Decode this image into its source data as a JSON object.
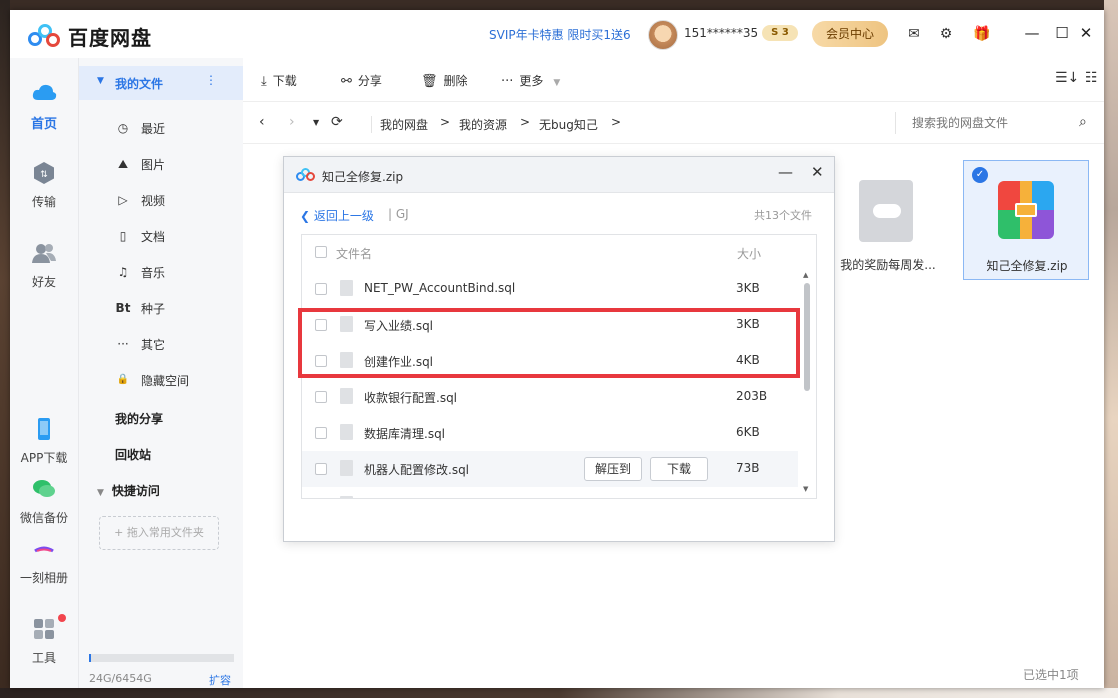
{
  "app": {
    "brand": "百度网盘",
    "promo": "SVIP年卡特惠 限时买1送6",
    "username": "151******35",
    "level": "3",
    "vip_center": "会员中心"
  },
  "leftnav": {
    "items": [
      {
        "label": "首页"
      },
      {
        "label": "传输"
      },
      {
        "label": "好友"
      },
      {
        "label": "APP下载"
      },
      {
        "label": "微信备份"
      },
      {
        "label": "一刻相册"
      },
      {
        "label": "工具"
      }
    ]
  },
  "sidebar": {
    "my_files": "我的文件",
    "items": [
      {
        "label": "最近",
        "icon": "◷"
      },
      {
        "label": "图片",
        "icon": "⛰"
      },
      {
        "label": "视频",
        "icon": "▷"
      },
      {
        "label": "文档",
        "icon": "▯"
      },
      {
        "label": "音乐",
        "icon": "♫"
      },
      {
        "label": "种子",
        "icon": "Bt"
      },
      {
        "label": "其它",
        "icon": "···"
      },
      {
        "label": "隐藏空间",
        "icon": "🔒"
      }
    ],
    "my_share": "我的分享",
    "recycle": "回收站",
    "quick_access": "快捷访问",
    "drop_hint": "+ 拖入常用文件夹",
    "quota": "24G/6454G",
    "expand": "扩容"
  },
  "toolbar": {
    "download": "下载",
    "share": "分享",
    "delete": "删除",
    "more": "更多"
  },
  "path": {
    "crumbs": [
      "我的网盘",
      "我的资源",
      "无bug知己"
    ],
    "search_placeholder": "搜索我的网盘文件"
  },
  "files": [
    {
      "name": "我的奖励每周发..."
    },
    {
      "name": "知己全修复.zip"
    }
  ],
  "status": "已选中1项",
  "dialog": {
    "title": "知己全修复.zip",
    "back": "返回上一级",
    "current": "| GJ",
    "count": "共13个文件",
    "col_name": "文件名",
    "col_size": "大小",
    "rows": [
      {
        "name": "NET_PW_AccountBind.sql",
        "size": "3KB"
      },
      {
        "name": "写入业绩.sql",
        "size": "3KB"
      },
      {
        "name": "创建作业.sql",
        "size": "4KB"
      },
      {
        "name": "收款银行配置.sql",
        "size": "203B"
      },
      {
        "name": "数据库清理.sql",
        "size": "6KB"
      },
      {
        "name": "机器人配置修改.sql",
        "size": "73B"
      }
    ],
    "extract_btn": "解压到",
    "download_btn": "下载"
  },
  "colors": {
    "accent": "#2b76e5",
    "highlight": "#e8383e"
  }
}
